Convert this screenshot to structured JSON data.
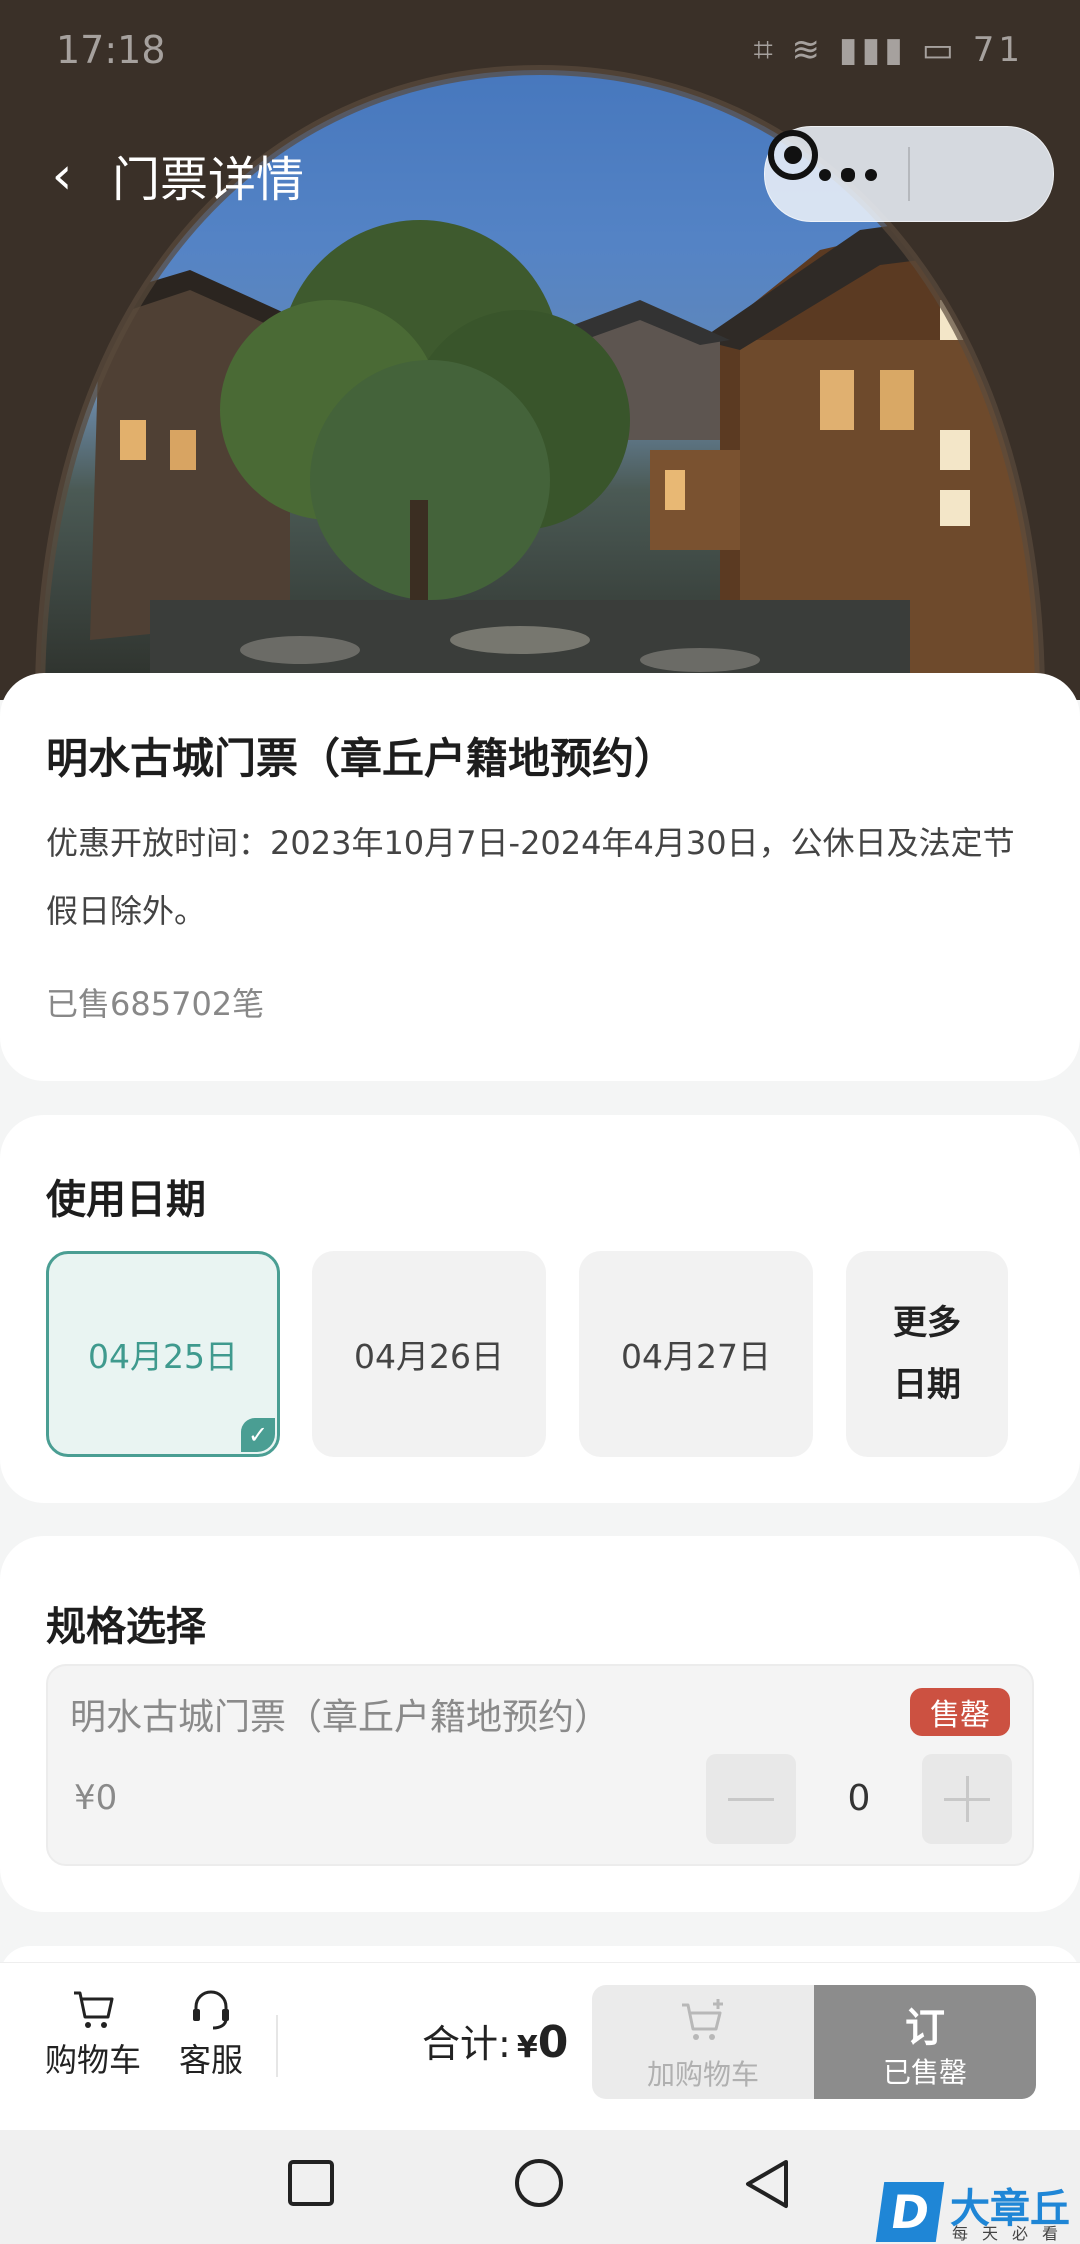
{
  "status_bar": {
    "time": "17:18",
    "indicators": "⌗ ≋ ▮▮▮ ▭ 71"
  },
  "header": {
    "back_icon": "‹",
    "title": "门票详情"
  },
  "ticket": {
    "title": "明水古城门票（章丘户籍地预约）",
    "description": "优惠开放时间：2023年10月7日-2024年4月30日，公休日及法定节假日除外。",
    "sold": "已售685702笔"
  },
  "date_section": {
    "title": "使用日期",
    "dates": [
      {
        "label": "04月25日",
        "selected": true
      },
      {
        "label": "04月26日",
        "selected": false
      },
      {
        "label": "04月27日",
        "selected": false
      }
    ],
    "more_line1": "更多",
    "more_line2": "日期"
  },
  "spec_section": {
    "title": "规格选择",
    "item_name": "明水古城门票（章丘户籍地预约）",
    "badge": "售罄",
    "price": "¥0",
    "quantity": "0"
  },
  "bottom_bar": {
    "cart_label": "购物车",
    "service_label": "客服",
    "total_label": "合计:",
    "currency": "¥",
    "total_amount": "0",
    "add_cart_label": "加购物车",
    "order_label": "订",
    "order_status": "已售罄"
  },
  "watermark": {
    "logo": "D",
    "text": "大章丘",
    "sub": "每天必看"
  },
  "colors": {
    "accent": "#4a9e93",
    "badge_red": "#cc5141",
    "order_gray": "#8c8c8c"
  }
}
